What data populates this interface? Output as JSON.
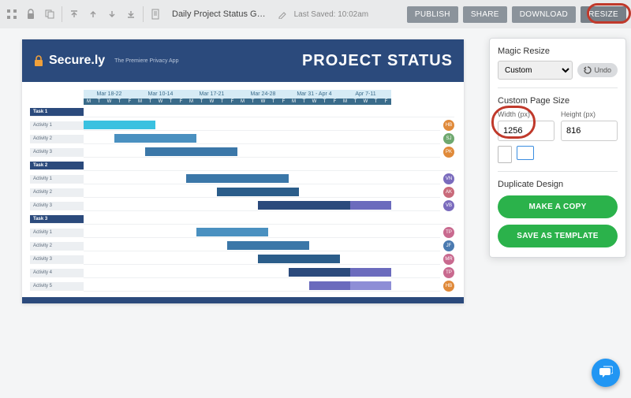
{
  "topbar": {
    "title": "Daily Project Status G…",
    "last_saved_label": "Last Saved:",
    "last_saved_time": "10:02am",
    "publish": "PUBLISH",
    "share": "SHARE",
    "download": "DOWNLOAD",
    "resize": "RESIZE"
  },
  "doc": {
    "brand": "Secure.ly",
    "tagline": "The Premiere Privacy App",
    "title": "PROJECT STATUS"
  },
  "chart_data": {
    "type": "bar",
    "orientation": "horizontal",
    "title": "PROJECT STATUS",
    "xlabel": "",
    "ylabel": "",
    "weeks": [
      {
        "label": "Mar 18-22",
        "days": [
          "M",
          "T",
          "W",
          "T",
          "F"
        ]
      },
      {
        "label": "Mar 10-14",
        "days": [
          "M",
          "T",
          "W",
          "T",
          "F"
        ]
      },
      {
        "label": "Mar 17-21",
        "days": [
          "M",
          "T",
          "W",
          "T",
          "F"
        ]
      },
      {
        "label": "Mar 24-28",
        "days": [
          "M",
          "T",
          "W",
          "T",
          "F"
        ]
      },
      {
        "label": "Mar 31 - Apr 4",
        "days": [
          "M",
          "T",
          "W",
          "T",
          "F"
        ]
      },
      {
        "label": "Apr 7-11",
        "days": [
          "M",
          "T",
          "W",
          "T",
          "F"
        ]
      }
    ],
    "rows": [
      {
        "type": "task",
        "label": "Task 1"
      },
      {
        "type": "activity",
        "label": "Activity 1",
        "bars": [
          {
            "start": 0,
            "span": 7,
            "color": "cyan"
          }
        ],
        "owner": "HB",
        "badge": "or"
      },
      {
        "type": "activity",
        "label": "Activity 2",
        "bars": [
          {
            "start": 3,
            "span": 8,
            "color": "blue1"
          }
        ],
        "owner": "SJ",
        "badge": "gr"
      },
      {
        "type": "activity",
        "label": "Activity 3",
        "bars": [
          {
            "start": 6,
            "span": 9,
            "color": "blue2"
          }
        ],
        "owner": "PK",
        "badge": "or"
      },
      {
        "type": "task",
        "label": "Task 2"
      },
      {
        "type": "activity",
        "label": "Activity 1",
        "bars": [
          {
            "start": 10,
            "span": 10,
            "color": "blue2"
          }
        ],
        "owner": "VN",
        "badge": "pu"
      },
      {
        "type": "activity",
        "label": "Activity 2",
        "bars": [
          {
            "start": 13,
            "span": 8,
            "color": "blue3"
          }
        ],
        "owner": "AK",
        "badge": "pk"
      },
      {
        "type": "activity",
        "label": "Activity 3",
        "bars": [
          {
            "start": 17,
            "span": 9,
            "color": "navy"
          },
          {
            "start": 26,
            "span": 4,
            "color": "purple"
          }
        ],
        "owner": "VB",
        "badge": "pu"
      },
      {
        "type": "task",
        "label": "Task 3"
      },
      {
        "type": "activity",
        "label": "Activity 1",
        "bars": [
          {
            "start": 11,
            "span": 7,
            "color": "blue1"
          }
        ],
        "owner": "TP",
        "badge": "tp"
      },
      {
        "type": "activity",
        "label": "Activity 2",
        "bars": [
          {
            "start": 14,
            "span": 8,
            "color": "blue2"
          }
        ],
        "owner": "JF",
        "badge": "bl"
      },
      {
        "type": "activity",
        "label": "Activity 3",
        "bars": [
          {
            "start": 17,
            "span": 8,
            "color": "blue3"
          }
        ],
        "owner": "MR",
        "badge": "tp"
      },
      {
        "type": "activity",
        "label": "Activity 4",
        "bars": [
          {
            "start": 20,
            "span": 6,
            "color": "navy"
          },
          {
            "start": 26,
            "span": 4,
            "color": "purple"
          }
        ],
        "owner": "TP",
        "badge": "tp"
      },
      {
        "type": "activity",
        "label": "Activity 5",
        "bars": [
          {
            "start": 22,
            "span": 4,
            "color": "purple"
          },
          {
            "start": 26,
            "span": 4,
            "color": "lpurp"
          }
        ],
        "owner": "HB",
        "badge": "or"
      }
    ],
    "total_days": 30
  },
  "panel": {
    "magic_resize": "Magic Resize",
    "preset": "Custom",
    "undo": "Undo",
    "custom_size": "Custom Page Size",
    "width_label": "Width (px)",
    "height_label": "Height (px)",
    "width": "1256",
    "height": "816",
    "duplicate": "Duplicate Design",
    "copy": "MAKE A COPY",
    "template": "SAVE AS TEMPLATE"
  }
}
